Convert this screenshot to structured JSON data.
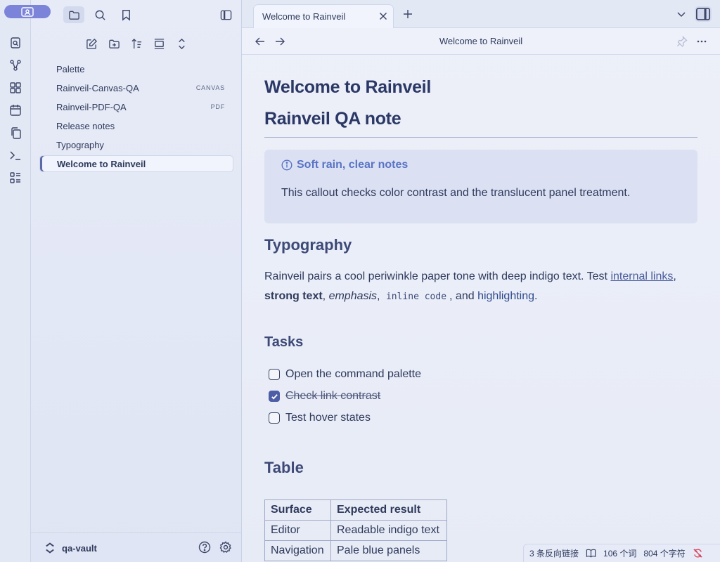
{
  "sidebar": {
    "files": [
      {
        "name": "Palette",
        "tag": ""
      },
      {
        "name": "Rainveil-Canvas-QA",
        "tag": "CANVAS"
      },
      {
        "name": "Rainveil-PDF-QA",
        "tag": "PDF"
      },
      {
        "name": "Release notes",
        "tag": ""
      },
      {
        "name": "Typography",
        "tag": ""
      },
      {
        "name": "Welcome to Rainveil",
        "tag": ""
      }
    ],
    "vault_name": "qa-vault"
  },
  "tab": {
    "title": "Welcome to Rainveil"
  },
  "nav": {
    "title": "Welcome to Rainveil"
  },
  "note": {
    "inline_title": "Welcome to Rainveil",
    "h1": "Rainveil QA note",
    "callout": {
      "title": "Soft rain, clear notes",
      "body": "This callout checks color contrast and the translucent panel treatment."
    },
    "typography": {
      "heading": "Typography",
      "p_start": "Rainveil pairs a cool periwinkle paper tone with deep indigo text. Test ",
      "link": "internal links",
      "comma1": ",",
      "strong": "strong text",
      "comma2": ", ",
      "em": "emphasis",
      "comma3": ", ",
      "code": "inline code",
      "and": ", and ",
      "highlight": "highlighting",
      "period": "."
    },
    "tasks": {
      "heading": "Tasks",
      "items": [
        {
          "label": "Open the command palette",
          "checked": false
        },
        {
          "label": "Check link contrast",
          "checked": true
        },
        {
          "label": "Test hover states",
          "checked": false
        }
      ]
    },
    "table": {
      "heading": "Table",
      "headers": [
        "Surface",
        "Expected result"
      ],
      "rows": [
        [
          "Editor",
          "Readable indigo text"
        ],
        [
          "Navigation",
          "Pale blue panels"
        ]
      ]
    }
  },
  "status": {
    "backlinks": "3 条反向链接",
    "words": "106 个词",
    "chars": "804 个字符"
  },
  "colors": {
    "accent": "#7b84d8",
    "heading": "#2b3866",
    "callout_title": "#5a73c4",
    "sync_error": "#d9445c"
  }
}
